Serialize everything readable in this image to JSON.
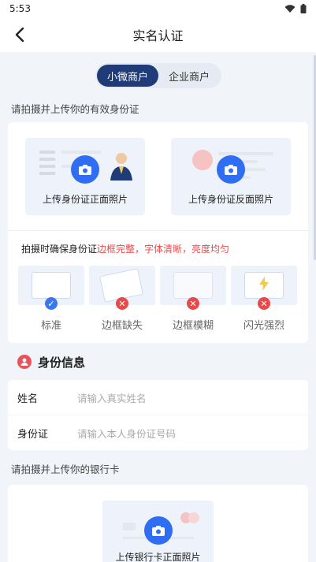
{
  "status": {
    "time": "5:53"
  },
  "header": {
    "title": "实名认证"
  },
  "tabs": [
    {
      "label": "小微商户",
      "active": true
    },
    {
      "label": "企业商户",
      "active": false
    }
  ],
  "id_upload": {
    "hint": "请拍摄并上传你的有效身份证",
    "front_label": "上传身份证正面照片",
    "back_label": "上传身份证反面照片"
  },
  "tips": {
    "prefix": "拍摄时确保身份证",
    "warning": "边框完整，字体清晰，亮度均匀",
    "samples": [
      {
        "label": "标准",
        "status": "ok"
      },
      {
        "label": "边框缺失",
        "status": "bad"
      },
      {
        "label": "边框模糊",
        "status": "bad"
      },
      {
        "label": "闪光强烈",
        "status": "bad"
      }
    ]
  },
  "identity": {
    "title": "身份信息",
    "name_label": "姓名",
    "name_placeholder": "请输入真实姓名",
    "id_label": "身份证",
    "id_placeholder": "请输入本人身份证号码"
  },
  "bank": {
    "hint": "请拍摄并上传你的银行卡",
    "front_label": "上传银行卡正面照片"
  },
  "colors": {
    "primary": "#1f3c78",
    "accent": "#2f6ef2",
    "danger": "#e84a4a"
  }
}
